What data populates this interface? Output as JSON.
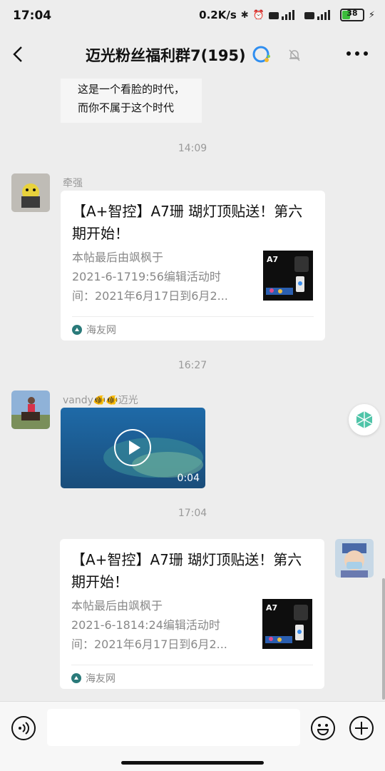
{
  "status_bar": {
    "time": "17:04",
    "net_speed": "0.2K/s",
    "battery_level": "38"
  },
  "header": {
    "title": "迈光粉丝福利群7(195)"
  },
  "messages": {
    "top_bubble_line1": "这是一个看脸的时代，",
    "top_bubble_line2": "而你不属于这个时代",
    "time1": "14:09",
    "msg1_sender": "牵强",
    "msg1_title": "【A+智控】A7珊 瑚灯顶贴送！第六期开始！",
    "msg1_desc1": "本帖最后由飒枫于",
    "msg1_desc2": "2021-6-1719:56编辑活动时",
    "msg1_desc3": "间：2021年6月17日到6月2...",
    "msg1_source": "海友网",
    "time2": "16:27",
    "msg2_sender": "vandy🐠🐠迈光",
    "msg2_video_duration": "0:04",
    "time3": "17:04",
    "msg3_title": "【A+智控】A7珊 瑚灯顶贴送！第六期开始！",
    "msg3_desc1": "本帖最后由飒枫于",
    "msg3_desc2": "2021-6-1814:24编辑活动时",
    "msg3_desc3": "间：2021年6月17日到6月2...",
    "msg3_source": "海友网",
    "thumb_label": "A7"
  },
  "colors": {
    "background": "#ededed",
    "card": "#ffffff",
    "battery_green": "#3bbd3b"
  }
}
